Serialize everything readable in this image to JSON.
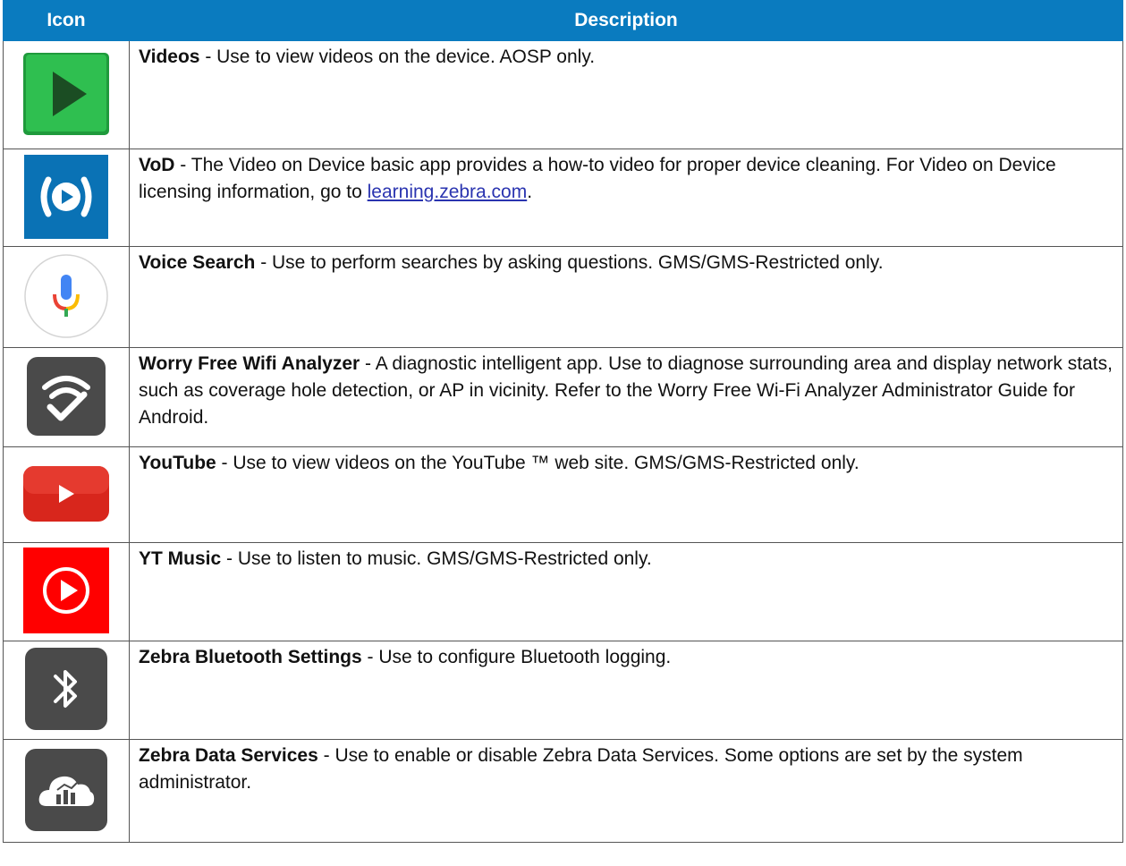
{
  "header": {
    "icon_col": "Icon",
    "description_col": "Description"
  },
  "rows": [
    {
      "name": "Videos",
      "text": " - Use to view videos on the device. AOSP only."
    },
    {
      "name": "VoD",
      "text_before": " - The Video on Device basic app provides a how-to video for proper device cleaning. For Video on Device licensing information, go to ",
      "link": "learning.zebra.com",
      "text_after": "."
    },
    {
      "name": "Voice Search",
      "text": " - Use to perform searches by asking questions. GMS/GMS-Restricted only."
    },
    {
      "name": "Worry Free Wifi Analyzer",
      "text": " - A diagnostic intelligent app. Use to diagnose surrounding area and display network stats, such as coverage hole detection, or AP in vicinity. Refer to the Worry Free Wi-Fi Analyzer Administrator Guide for Android."
    },
    {
      "name": "YouTube",
      "text": " - Use to view videos on the YouTube ™ web site. GMS/GMS-Restricted only."
    },
    {
      "name": "YT Music",
      "text": " - Use to listen to music. GMS/GMS-Restricted only."
    },
    {
      "name": "Zebra Bluetooth Settings",
      "text": " - Use to configure Bluetooth logging."
    },
    {
      "name": "Zebra Data Services",
      "text": " - Use to enable or disable Zebra Data Services. Some options are set by the system administrator."
    }
  ],
  "icons": [
    "videos-play-icon",
    "vod-icon",
    "microphone-icon",
    "wifi-analyzer-icon",
    "youtube-icon",
    "yt-music-icon",
    "bluetooth-icon",
    "cloud-data-icon"
  ],
  "colors": {
    "header_bg": "#0a7bbf",
    "link": "#2a34b0",
    "videos_green": "#2db34a",
    "vod_blue": "#0a72b5",
    "youtube_red": "#e02a20",
    "yt_music_red": "#ff0000",
    "dark_icon": "#4a4a4a"
  }
}
